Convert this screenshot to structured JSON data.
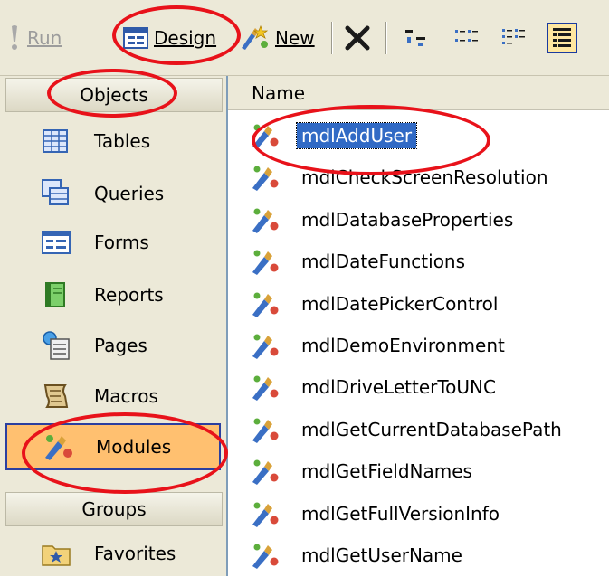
{
  "toolbar": {
    "run_label": "Run",
    "design_label": "Design",
    "new_label": "New",
    "delete_icon": "delete-x-icon",
    "view_icons": [
      "large-icons-icon",
      "small-icons-icon",
      "list-view-icon",
      "details-view-icon"
    ]
  },
  "sidebar": {
    "objects_header": "Objects",
    "items": [
      {
        "label": "Tables",
        "icon": "table-icon"
      },
      {
        "label": "Queries",
        "icon": "query-icon"
      },
      {
        "label": "Forms",
        "icon": "form-icon"
      },
      {
        "label": "Reports",
        "icon": "report-icon"
      },
      {
        "label": "Pages",
        "icon": "page-icon"
      },
      {
        "label": "Macros",
        "icon": "macro-icon"
      },
      {
        "label": "Modules",
        "icon": "module-icon"
      }
    ],
    "groups_header": "Groups",
    "groups": [
      {
        "label": "Favorites",
        "icon": "favorites-folder-icon"
      }
    ]
  },
  "list": {
    "column_header": "Name",
    "items": [
      "mdlAddUser",
      "mdlCheckScreenResolution",
      "mdlDatabaseProperties",
      "mdlDateFunctions",
      "mdlDatePickerControl",
      "mdlDemoEnvironment",
      "mdlDriveLetterToUNC",
      "mdlGetCurrentDatabasePath",
      "mdlGetFieldNames",
      "mdlGetFullVersionInfo",
      "mdlGetUserName"
    ]
  },
  "colors": {
    "annotation": "#e8121a",
    "selection": "#316ac5",
    "selected_category": "#ffc070",
    "panel": "#ece9d8"
  }
}
